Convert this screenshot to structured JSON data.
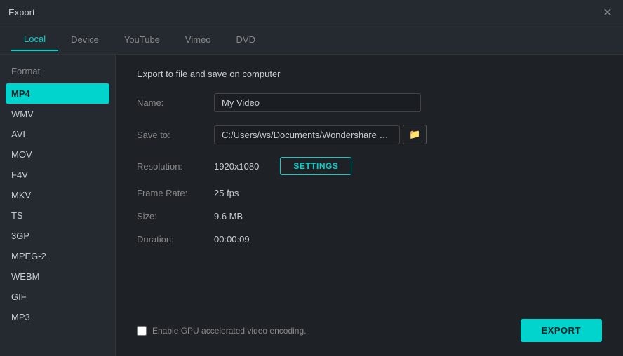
{
  "titleBar": {
    "title": "Export",
    "closeLabel": "✕"
  },
  "tabs": [
    {
      "id": "local",
      "label": "Local",
      "active": true
    },
    {
      "id": "device",
      "label": "Device",
      "active": false
    },
    {
      "id": "youtube",
      "label": "YouTube",
      "active": false
    },
    {
      "id": "vimeo",
      "label": "Vimeo",
      "active": false
    },
    {
      "id": "dvd",
      "label": "DVD",
      "active": false
    }
  ],
  "sidebar": {
    "header": "Format",
    "items": [
      {
        "id": "mp4",
        "label": "MP4",
        "active": true
      },
      {
        "id": "wmv",
        "label": "WMV",
        "active": false
      },
      {
        "id": "avi",
        "label": "AVI",
        "active": false
      },
      {
        "id": "mov",
        "label": "MOV",
        "active": false
      },
      {
        "id": "f4v",
        "label": "F4V",
        "active": false
      },
      {
        "id": "mkv",
        "label": "MKV",
        "active": false
      },
      {
        "id": "ts",
        "label": "TS",
        "active": false
      },
      {
        "id": "3gp",
        "label": "3GP",
        "active": false
      },
      {
        "id": "mpeg2",
        "label": "MPEG-2",
        "active": false
      },
      {
        "id": "webm",
        "label": "WEBM",
        "active": false
      },
      {
        "id": "gif",
        "label": "GIF",
        "active": false
      },
      {
        "id": "mp3",
        "label": "MP3",
        "active": false
      }
    ]
  },
  "content": {
    "title": "Export to file and save on computer",
    "fields": {
      "name": {
        "label": "Name:",
        "value": "My Video"
      },
      "saveTo": {
        "label": "Save to:",
        "value": "C:/Users/ws/Documents/Wondershare Filmo",
        "folderIcon": "📁"
      },
      "resolution": {
        "label": "Resolution:",
        "value": "1920x1080",
        "settingsLabel": "SETTINGS"
      },
      "frameRate": {
        "label": "Frame Rate:",
        "value": "25 fps"
      },
      "size": {
        "label": "Size:",
        "value": "9.6 MB"
      },
      "duration": {
        "label": "Duration:",
        "value": "00:00:09"
      }
    },
    "gpuLabel": "Enable GPU accelerated video encoding.",
    "exportLabel": "EXPORT"
  }
}
